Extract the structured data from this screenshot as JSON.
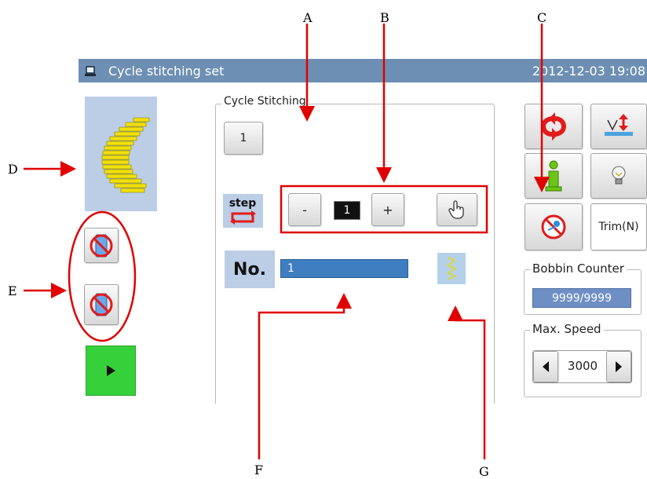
{
  "window": {
    "title": "Cycle stitching set",
    "datetime": "2012-12-03  19:08"
  },
  "group": {
    "label": "Cycle Stitching"
  },
  "pattern_index_button": "1",
  "step_control": {
    "minus_label": "-",
    "value": "1",
    "plus_label": "+"
  },
  "number_row": {
    "label": "No.",
    "value": "1"
  },
  "right_panel": {
    "trim_label": "Trim(N)",
    "bobbin_counter": {
      "label": "Bobbin Counter",
      "value": "9999/9999"
    },
    "max_speed": {
      "label": "Max. Speed",
      "value": "3000"
    }
  },
  "annotations": {
    "A": "A",
    "B": "B",
    "C": "C",
    "D": "D",
    "E": "E",
    "F": "F",
    "G": "G"
  },
  "colors": {
    "titlebar": "#6d8fb3",
    "annotation": "#e00000",
    "play": "#36d13a",
    "field": "#3d7dc0"
  },
  "icons": [
    "app-window-icon",
    "pattern-preview-icon",
    "no-stitch-icon",
    "play-icon",
    "step-cycle-icon",
    "hand-pointer-icon",
    "zigzag-icon",
    "cycle-arrows-icon",
    "needle-up-icon",
    "info-icon",
    "lightbulb-icon",
    "thread-trim-off-icon",
    "arrow-left-icon",
    "arrow-right-icon"
  ]
}
